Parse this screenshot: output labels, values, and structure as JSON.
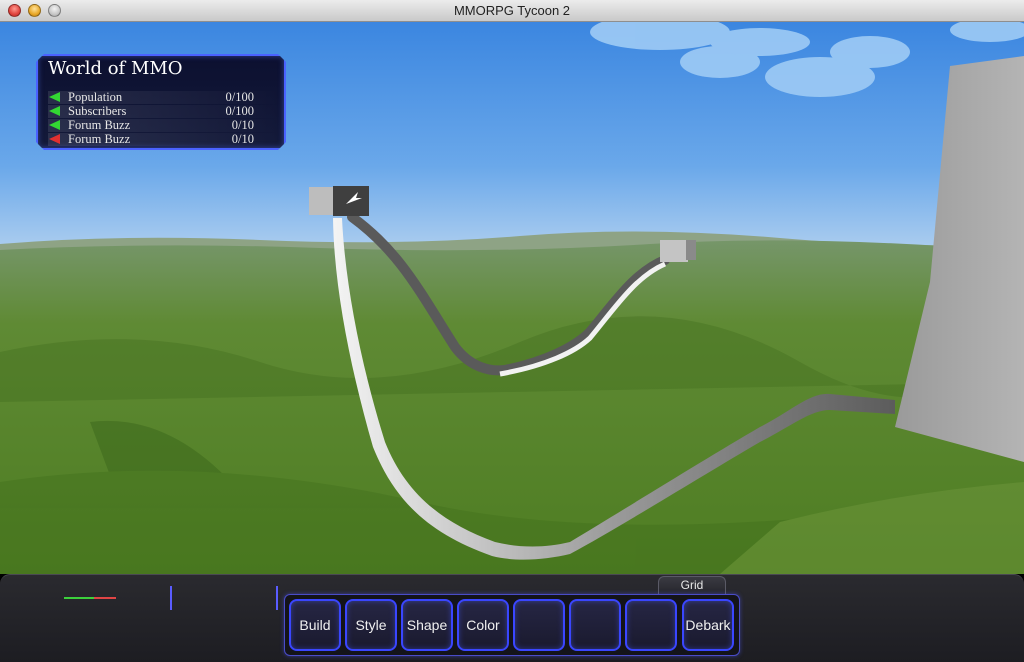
{
  "window": {
    "title": "MMORPG Tycoon 2"
  },
  "stats_panel": {
    "world_name": "World of MMO",
    "rows": [
      {
        "label": "Population",
        "value": "0/100",
        "trend": "up",
        "trend_color": "#33d633"
      },
      {
        "label": "Subscribers",
        "value": "0/100",
        "trend": "up",
        "trend_color": "#33d633"
      },
      {
        "label": "Forum Buzz",
        "value": "0/10",
        "trend": "up",
        "trend_color": "#33d633"
      },
      {
        "label": "Forum Buzz",
        "value": "0/10",
        "trend": "down",
        "trend_color": "#e03030"
      }
    ]
  },
  "toolbar": {
    "grid_tab": "Grid",
    "buttons": [
      {
        "label": "Build"
      },
      {
        "label": "Style"
      },
      {
        "label": "Shape"
      },
      {
        "label": "Color"
      },
      {
        "label": ""
      },
      {
        "label": ""
      },
      {
        "label": ""
      },
      {
        "label": "Debark"
      }
    ]
  },
  "colors": {
    "accent_blue": "#3a46ff",
    "sky": "#4a8fd9",
    "grass": "#5a8a2e"
  }
}
